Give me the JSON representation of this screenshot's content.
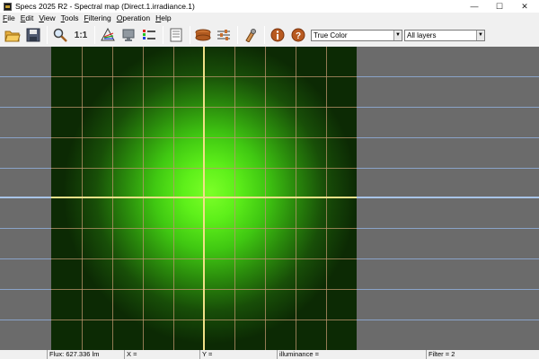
{
  "window": {
    "title": "Specs 2025 R2 - Spectral map (Direct.1.irradiance.1)",
    "minimize": "—",
    "maximize": "☐",
    "close": "✕"
  },
  "menu": {
    "items": [
      {
        "underline": "F",
        "rest": "ile"
      },
      {
        "underline": "E",
        "rest": "dit"
      },
      {
        "underline": "V",
        "rest": "iew"
      },
      {
        "underline": "T",
        "rest": "ools"
      },
      {
        "underline": "F",
        "rest": "iltering"
      },
      {
        "underline": "O",
        "rest": "peration"
      },
      {
        "underline": "H",
        "rest": "elp"
      }
    ]
  },
  "toolbar": {
    "zoom_ratio_label": "1:1",
    "color_mode": "True Color",
    "layer_select": "All layers"
  },
  "status": {
    "flux": "Flux: 627.336 lm",
    "x": "X =",
    "y": "Y =",
    "illuminance": "illuminance =",
    "filter": "Filter = 2"
  },
  "colors": {
    "map_center": "#7cff28",
    "grid_line": "#be966e",
    "crosshair": "#f0e088",
    "background": "#6b6b6b"
  }
}
